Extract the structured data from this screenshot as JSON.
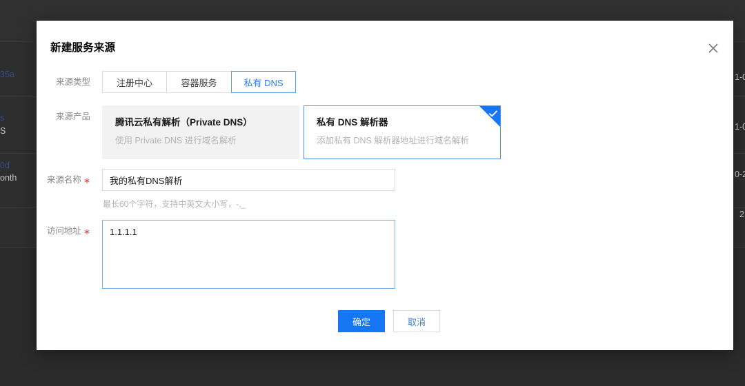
{
  "background": {
    "fragments_left": [
      "35a",
      "s",
      "S",
      "0d",
      "onth"
    ],
    "fragments_right": [
      "1-0",
      "1-0",
      "0-2",
      "2"
    ]
  },
  "modal": {
    "title": "新建服务来源",
    "close_icon": "close-icon",
    "source_type": {
      "label": "来源类型",
      "tabs": [
        {
          "label": "注册中心",
          "active": false
        },
        {
          "label": "容器服务",
          "active": false
        },
        {
          "label": "私有 DNS",
          "active": true
        }
      ]
    },
    "source_product": {
      "label": "来源产品",
      "cards": [
        {
          "title": "腾讯云私有解析（Private DNS）",
          "desc": "使用 Private DNS 进行域名解析",
          "selected": false
        },
        {
          "title": "私有 DNS 解析器",
          "desc": "添加私有 DNS 解析器地址进行域名解析",
          "selected": true
        }
      ],
      "check_icon": "check-icon"
    },
    "source_name": {
      "label": "来源名称",
      "required": true,
      "value": "我的私有DNS解析",
      "placeholder": "",
      "hint": "最长60个字符，支持中英文大小写，-,_"
    },
    "access_address": {
      "label": "访问地址",
      "required": true,
      "value": "1.1.1.1",
      "placeholder": ""
    },
    "footer": {
      "confirm_label": "确定",
      "cancel_label": "取消"
    }
  },
  "colors": {
    "accent": "#1677f5",
    "active_tab": "#2a7fe8",
    "required": "#e54545",
    "card_selected_border": "#4a90e8",
    "backdrop": "#303030"
  }
}
